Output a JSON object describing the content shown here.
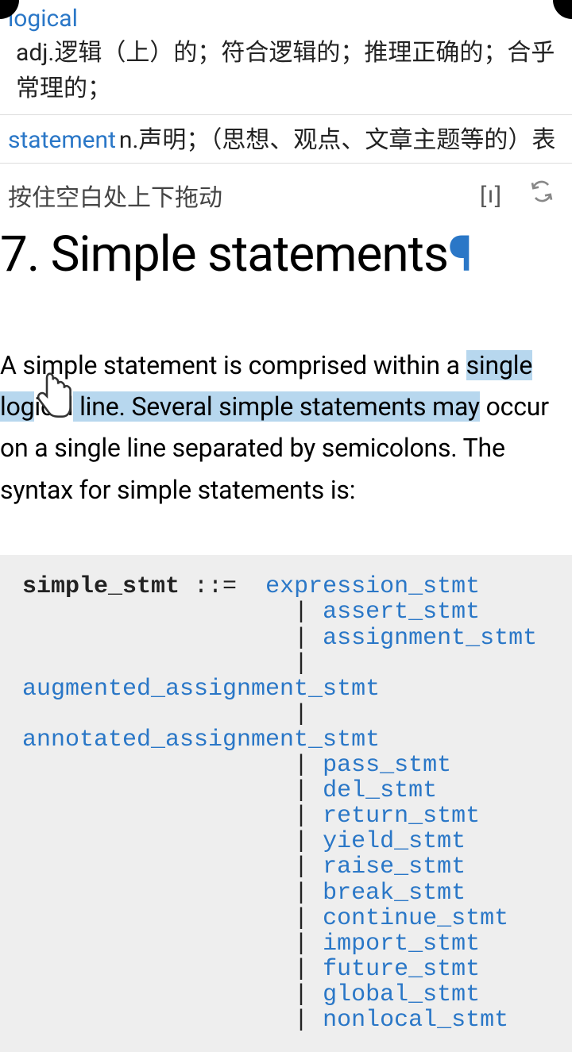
{
  "dictionary": {
    "entries": [
      {
        "word": "logical",
        "definition": "adj.逻辑（上）的；符合逻辑的；推理正确的；合乎常理的；"
      },
      {
        "word": "statement",
        "definition": "n.声明；（思想、观点、文章主题等的）表"
      }
    ]
  },
  "toolbar": {
    "hint": "按住空白处上下拖动",
    "brackets": "[ı]"
  },
  "heading": {
    "number": "7.",
    "title": "Simple statements",
    "pilcrow": "¶"
  },
  "paragraph": {
    "pre": "A simple statement is comprised within a ",
    "hl1": "single log",
    "mid1": "ical",
    "hl2": " line. Several simple statements may",
    "post": " occur on a single line separated by semicolons. The syntax for simple statements is:"
  },
  "code": {
    "lhs": "simple_stmt",
    "op": " ::=  ",
    "tokens": {
      "expression_stmt": "expression_stmt",
      "assert_stmt": "assert_stmt",
      "assignment_stmt": "assignment_stmt",
      "augmented_assignment_stmt": "augmented_assignment_stmt",
      "annotated_assignment_stmt": "annotated_assignment_stmt",
      "pass_stmt": "pass_stmt",
      "del_stmt": "del_stmt",
      "return_stmt": "return_stmt",
      "yield_stmt": "yield_stmt",
      "raise_stmt": "raise_stmt",
      "break_stmt": "break_stmt",
      "continue_stmt": "continue_stmt",
      "import_stmt": "import_stmt",
      "future_stmt": "future_stmt",
      "global_stmt": "global_stmt",
      "nonlocal_stmt": "nonlocal_stmt"
    }
  }
}
